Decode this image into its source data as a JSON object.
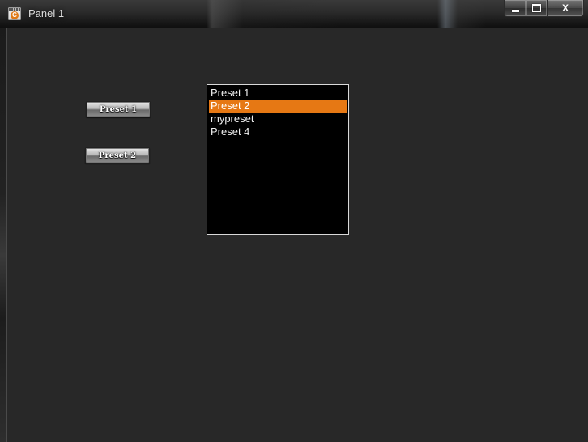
{
  "window": {
    "title": "Panel 1",
    "app_icon": "app-icon",
    "caption_buttons": {
      "minimize_icon": "minimize-icon",
      "maximize_icon": "maximize-icon",
      "close_label": "X"
    }
  },
  "buttons": [
    {
      "label": "Preset 1"
    },
    {
      "label": "Preset 2"
    }
  ],
  "preset_list": {
    "items": [
      {
        "label": "Preset 1",
        "selected": false
      },
      {
        "label": "Preset 2",
        "selected": true
      },
      {
        "label": "mypreset",
        "selected": false
      },
      {
        "label": "Preset 4",
        "selected": false
      }
    ],
    "selection_color": "#e67814"
  },
  "colors": {
    "client_background": "#282828",
    "list_background": "#000000"
  }
}
